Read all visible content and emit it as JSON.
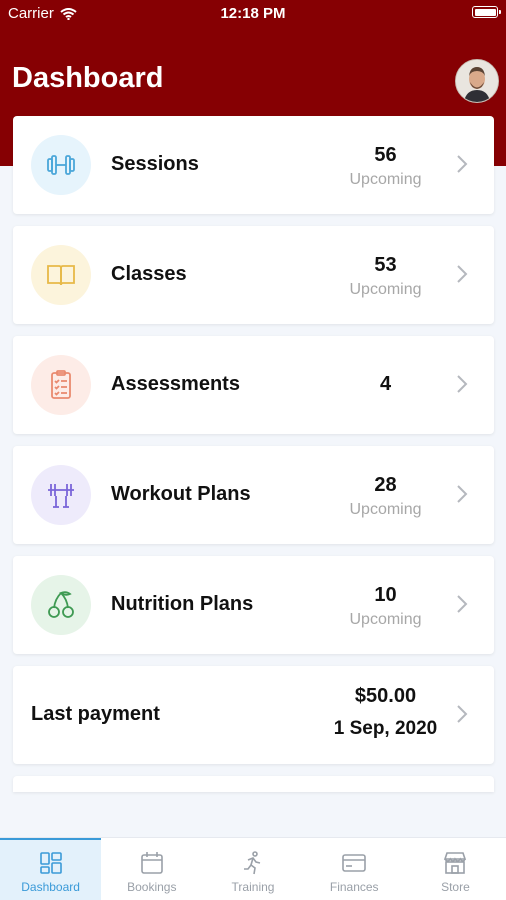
{
  "status_bar": {
    "carrier": "Carrier",
    "time": "12:18 PM"
  },
  "header": {
    "title": "Dashboard"
  },
  "cards": [
    {
      "label": "Sessions",
      "value": "56",
      "sub": "Upcoming",
      "icon": "dumbbell-icon",
      "color": "#4aa6d9",
      "bg": "#e6f4fc"
    },
    {
      "label": "Classes",
      "value": "53",
      "sub": "Upcoming",
      "icon": "book-icon",
      "color": "#e7b948",
      "bg": "#fcf4dc"
    },
    {
      "label": "Assessments",
      "value": "4",
      "icon": "checklist-icon",
      "color": "#e98a6f",
      "bg": "#fdece7"
    },
    {
      "label": "Workout Plans",
      "value": "28",
      "sub": "Upcoming",
      "icon": "barbell-icon",
      "color": "#7a66d9",
      "bg": "#eeebfb"
    },
    {
      "label": "Nutrition Plans",
      "value": "10",
      "sub": "Upcoming",
      "icon": "cherries-icon",
      "color": "#3f9a53",
      "bg": "#e6f4e8"
    }
  ],
  "payment": {
    "label": "Last payment",
    "amount": "$50.00",
    "date": "1 Sep, 2020"
  },
  "tabs": [
    {
      "label": "Dashboard",
      "icon": "dashboard-icon",
      "active": true
    },
    {
      "label": "Bookings",
      "icon": "calendar-icon"
    },
    {
      "label": "Training",
      "icon": "runner-icon"
    },
    {
      "label": "Finances",
      "icon": "credit-card-icon"
    },
    {
      "label": "Store",
      "icon": "store-icon"
    }
  ],
  "colors": {
    "header": "#860003",
    "active_tab": "#3a9ad8"
  }
}
